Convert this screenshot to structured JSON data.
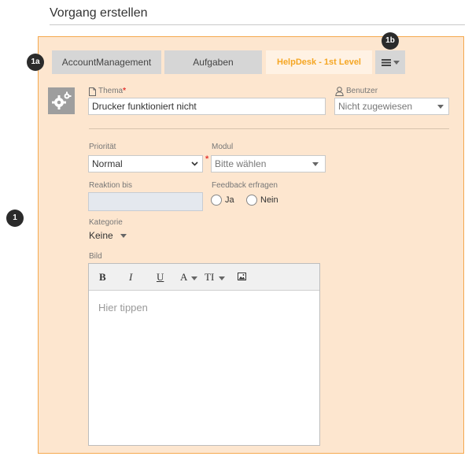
{
  "page": {
    "title": "Vorgang erstellen"
  },
  "badges": {
    "main": "1",
    "tabs": "1a",
    "menu": "1b"
  },
  "tabs": [
    {
      "label": "AccountManagement",
      "active": false
    },
    {
      "label": "Aufgaben",
      "active": false
    },
    {
      "label": "HelpDesk - 1st Level",
      "active": true
    }
  ],
  "form": {
    "thema": {
      "label": "Thema",
      "required_mark": "*",
      "value": "Drucker funktioniert nicht",
      "icon": "document-icon"
    },
    "benutzer": {
      "label": "Benutzer",
      "value": "Nicht zugewiesen",
      "icon": "user-icon"
    },
    "prioritaet": {
      "label": "Priorität",
      "value": "Normal"
    },
    "modul": {
      "label": "Modul",
      "required_mark": "*",
      "value": "Bitte wählen"
    },
    "reaktion": {
      "label": "Reaktion bis",
      "value": ""
    },
    "feedback": {
      "label": "Feedback erfragen",
      "options": [
        "Ja",
        "Nein"
      ]
    },
    "kategorie": {
      "label": "Kategorie",
      "value": "Keine"
    },
    "bild": {
      "label": "Bild",
      "placeholder": "Hier tippen",
      "toolbar": {
        "bold": "B",
        "italic": "I",
        "underline": "U",
        "font_color": "A",
        "font_size": "TI"
      }
    }
  },
  "colors": {
    "panel_bg": "#fde6cf",
    "panel_border": "#f5a94f",
    "active_tab_text": "#f5a623",
    "required": "#e53935"
  }
}
